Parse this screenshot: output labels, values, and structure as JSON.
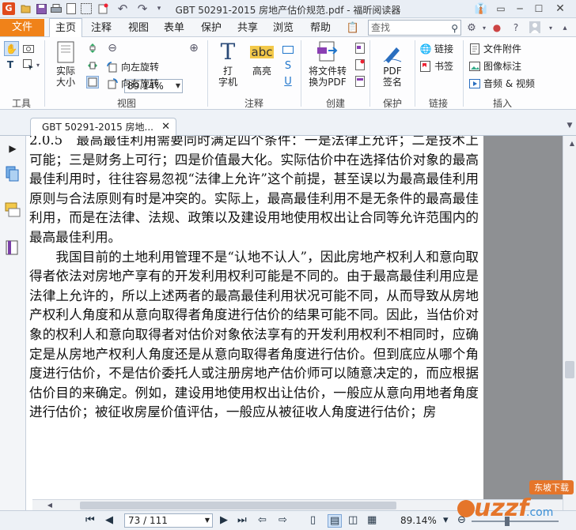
{
  "app": {
    "window_title": "GBT 50291-2015 房地产估价规范.pdf - 福昕阅读器",
    "accent_color": "#f08219"
  },
  "menu": {
    "file": "文件",
    "tabs": [
      "主页",
      "注释",
      "视图",
      "表单",
      "保护",
      "共享",
      "浏览",
      "帮助"
    ],
    "active_tab": "主页",
    "search_placeholder": "查找"
  },
  "ribbon": {
    "tools_group": "工具",
    "view_group": "视图",
    "comment_group": "注释",
    "create_group": "创建",
    "protect_group": "保护",
    "link_group": "链接",
    "insert_group": "插入",
    "actual_size": "实际\n大小",
    "zoom_value": "89.14%",
    "rotate_left": "向左旋转",
    "rotate_right": "向右旋转",
    "typewriter": "打\n字机",
    "highlight": "高亮",
    "abc": "abc",
    "convert_pdf": "将文件转\n换为PDF",
    "pdf_sign": "PDF\n签名",
    "link": "链接",
    "bookmark": "书签",
    "file_attach": "文件附件",
    "image_annot": "图像标注",
    "audio_video": "音频 & 视频"
  },
  "doc_tab": {
    "title": "GBT 50291-2015 房地..."
  },
  "document": {
    "paragraphs": [
      "2.0.5　最高最佳利用需要同时满足四个条件：一是法律上允许；二是技术上可能；三是财务上可行；四是价值最大化。实际估价中在选择估价对象的最高最佳利用时，往往容易忽视“法律上允许”这个前提，甚至误以为最高最佳利用原则与合法原则有时是冲突的。实际上，最高最佳利用不是无条件的最高最佳利用，而是在法律、法规、政策以及建设用地使用权出让合同等允许范围内的最高最佳利用。",
      "　　我国目前的土地利用管理不是“认地不认人”，因此房地产权利人和意向取得者依法对房地产享有的开发利用权利可能是不同的。由于最高最佳利用应是法律上允许的，所以上述两者的最高最佳利用状况可能不同，从而导致从房地产权利人角度和从意向取得者角度进行估价的结果可能不同。因此，当估价对象的权利人和意向取得者对估价对象依法享有的开发利用权利不相同时，应确定是从房地产权利人角度还是从意向取得者角度进行估价。但到底应从哪个角度进行估价，不是估价委托人或注册房地产估价师可以随意决定的，而应根据估价目的来确定。例如，建设用地使用权出让估价，一般应从意向用地者角度进行估价；被征收房屋价值评估，一般应从被征收人角度进行估价；房"
    ]
  },
  "status": {
    "page_indicator": "73 / 111",
    "zoom": "89.14%"
  },
  "watermark": {
    "text": "uzzf",
    "suffix": ".com",
    "tag": "东坡下载"
  }
}
